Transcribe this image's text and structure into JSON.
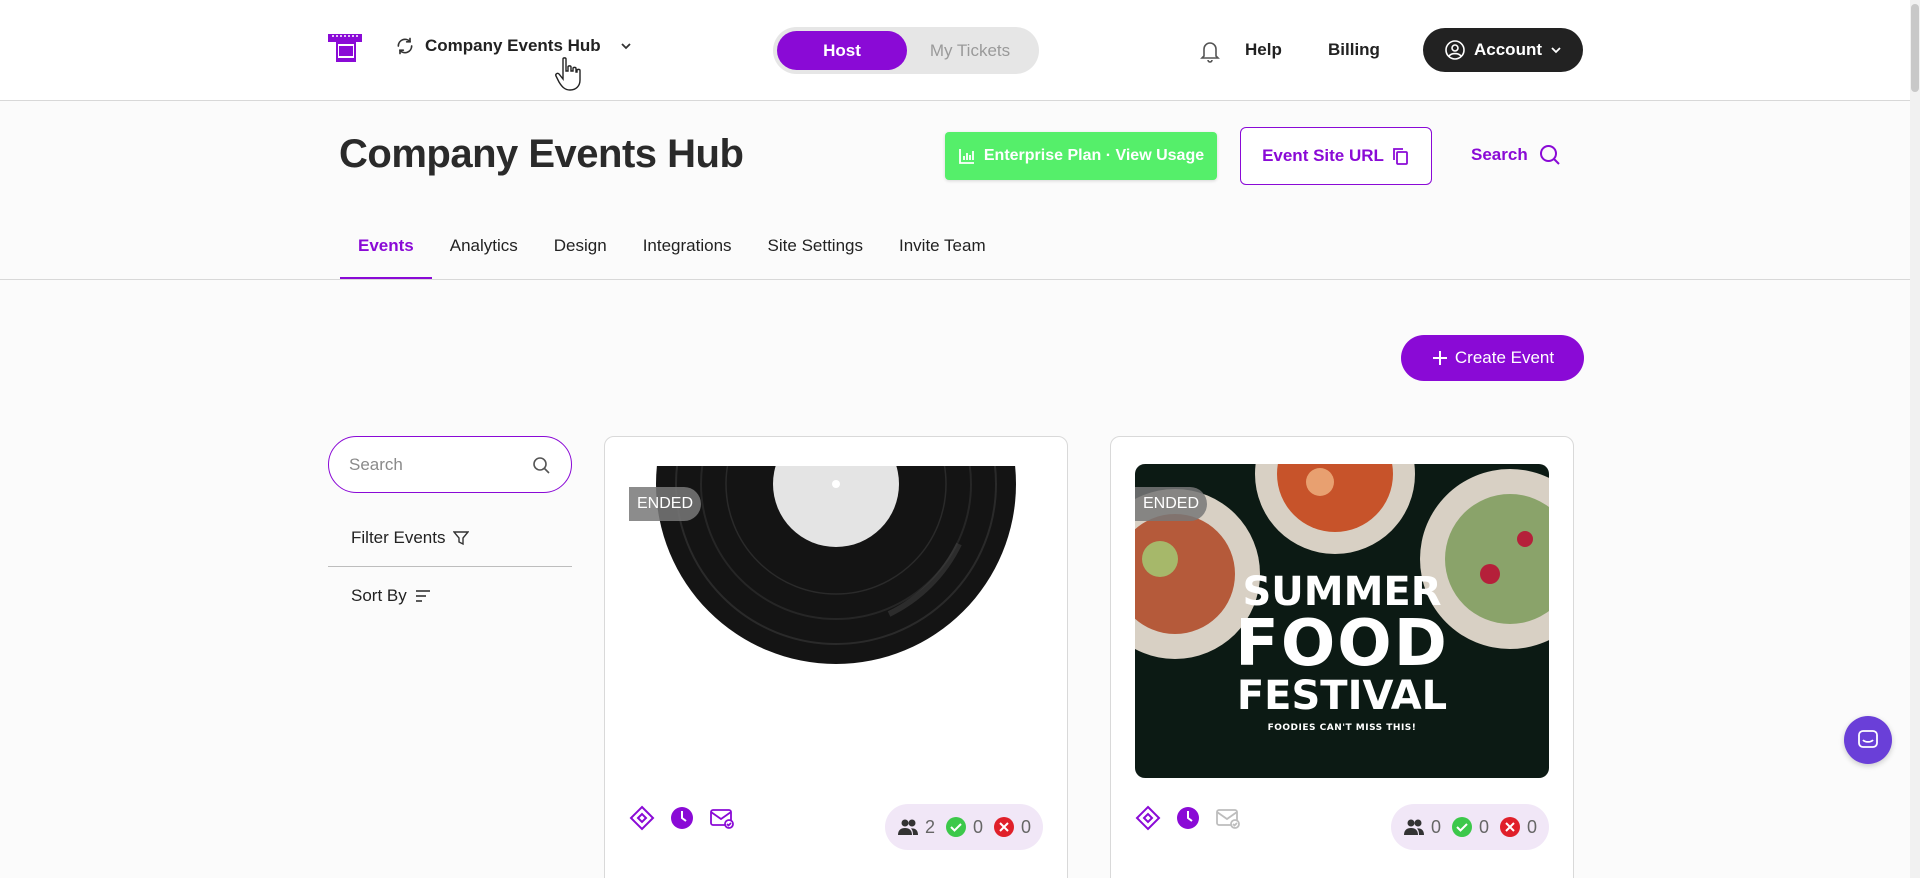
{
  "header": {
    "workspace_name": "Company Events Hub",
    "mode_host": "Host",
    "mode_tickets": "My Tickets",
    "help": "Help",
    "billing": "Billing",
    "account": "Account"
  },
  "page": {
    "title": "Company Events Hub",
    "plan_button": "Enterprise Plan · View Usage",
    "site_url_button": "Event Site URL",
    "search_link": "Search"
  },
  "tabs": [
    {
      "label": "Events",
      "active": true
    },
    {
      "label": "Analytics",
      "active": false
    },
    {
      "label": "Design",
      "active": false
    },
    {
      "label": "Integrations",
      "active": false
    },
    {
      "label": "Site Settings",
      "active": false
    },
    {
      "label": "Invite Team",
      "active": false
    }
  ],
  "actions": {
    "create_event": "Create Event"
  },
  "sidebar": {
    "search_placeholder": "Search",
    "filter_label": "Filter Events",
    "sort_label": "Sort By"
  },
  "events": [
    {
      "status": "ENDED",
      "image": "vinyl-record",
      "stats": {
        "attendees": "2",
        "approved": "0",
        "declined": "0"
      }
    },
    {
      "status": "ENDED",
      "image": "summer-food-festival",
      "image_text": {
        "line1": "SUMMER",
        "line2": "FOOD",
        "line3": "FESTIVAL",
        "tagline": "FOODIES CAN'T MISS THIS!"
      },
      "stats": {
        "attendees": "0",
        "approved": "0",
        "declined": "0"
      }
    }
  ],
  "colors": {
    "accent": "#8a0ad6",
    "plan_green": "#55ef6a",
    "dark": "#222222",
    "chat": "#6a3fd8"
  }
}
